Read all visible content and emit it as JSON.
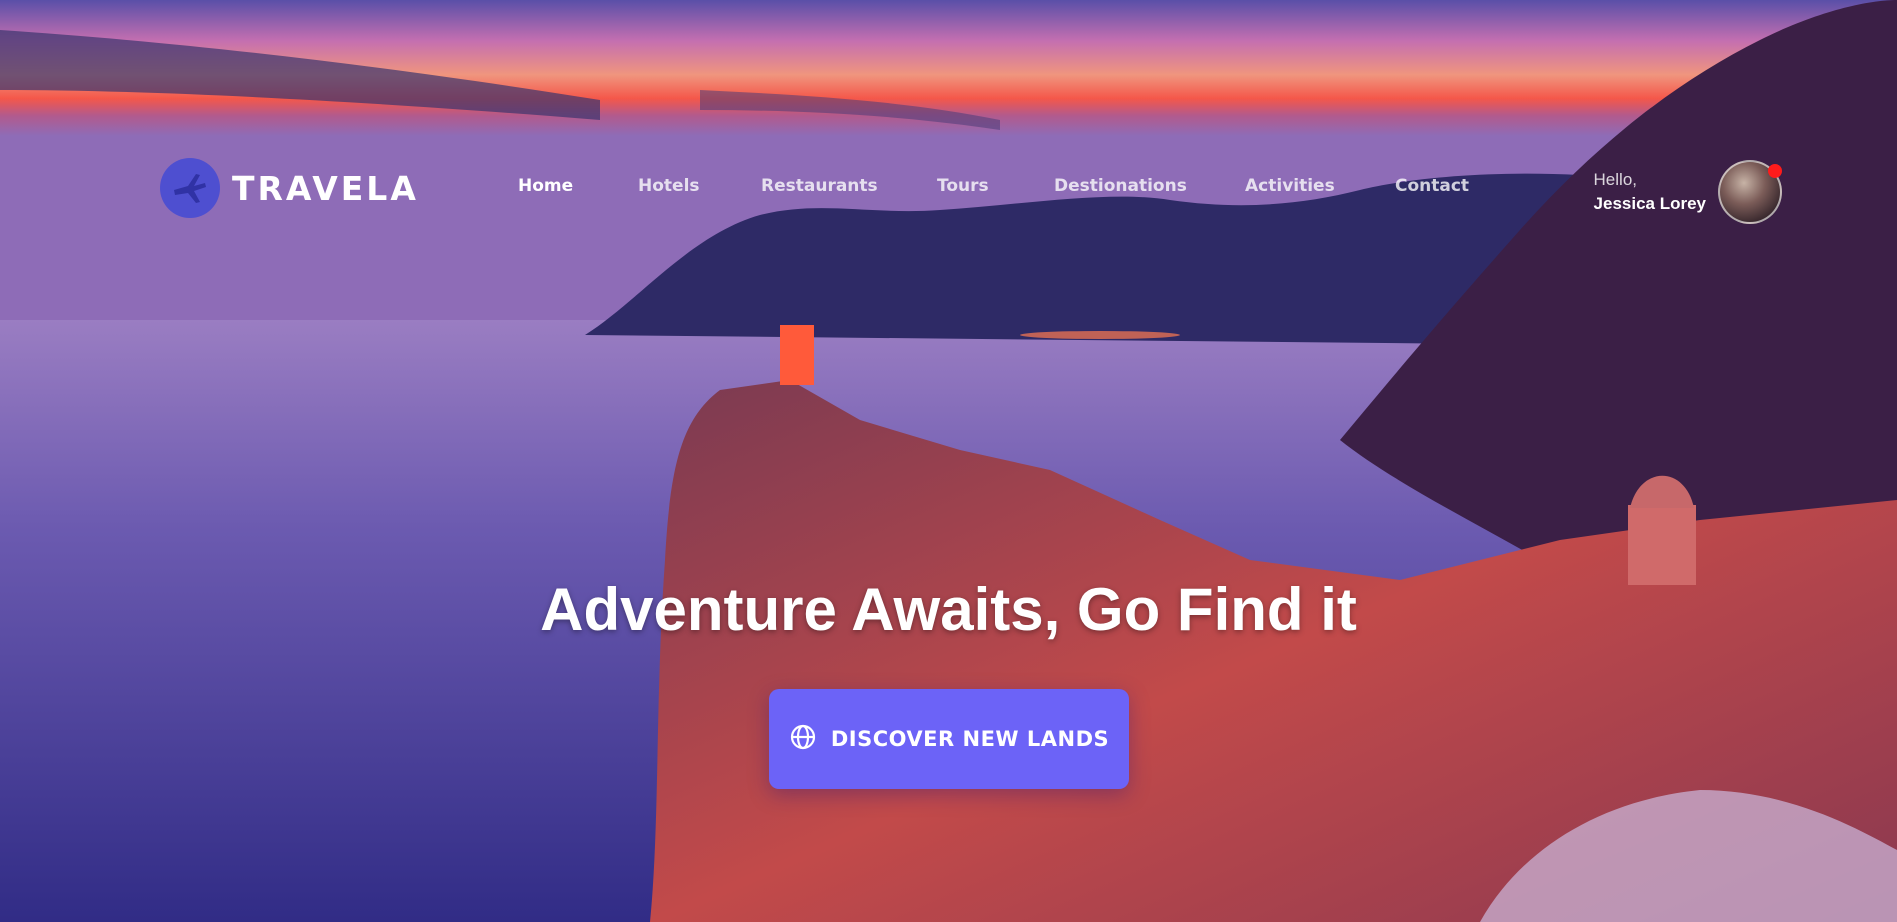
{
  "brand": {
    "name": "TRAVELA",
    "logo_icon": "airplane-icon",
    "color": "#4e4fd0"
  },
  "nav": {
    "items": [
      {
        "label": "Home",
        "active": true
      },
      {
        "label": "Hotels"
      },
      {
        "label": "Restaurants"
      },
      {
        "label": "Tours"
      },
      {
        "label": "Destionations"
      },
      {
        "label": "Activities"
      },
      {
        "label": "Contact"
      }
    ]
  },
  "user": {
    "greeting": "Hello,",
    "name": "Jessica Lorey",
    "notification_color": "#ff1b1b"
  },
  "hero": {
    "headline": "Adventure Awaits, Go Find it",
    "cta_label": "DISCOVER NEW LANDS",
    "cta_icon": "globe-icon",
    "cta_color": "#6c63f7"
  }
}
